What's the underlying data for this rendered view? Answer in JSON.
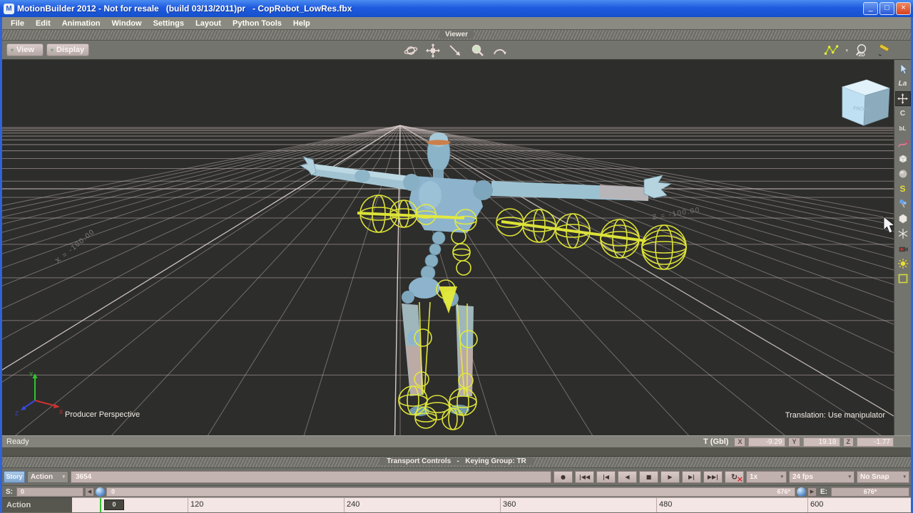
{
  "window": {
    "title": "MotionBuilder 2012 - Not for resale   (build 03/13/2011)pr   - CopRobot_LowRes.fbx",
    "app_icon_glyph": "M",
    "minimize_glyph": "_",
    "maximize_glyph": "□",
    "close_glyph": "×"
  },
  "menu_bar": {
    "items": [
      "File",
      "Edit",
      "Animation",
      "Window",
      "Settings",
      "Layout",
      "Python Tools",
      "Help"
    ]
  },
  "viewer": {
    "header": "Viewer",
    "view_button": "View",
    "display_button": "Display",
    "center_tools": [
      "orbit-icon",
      "pan-icon",
      "select-line-icon",
      "zoom-icon",
      "arc-rotate-icon"
    ],
    "right_tools": [
      "spline-icon",
      "zoom-2d-icon",
      "draw-icon"
    ],
    "zoom_2d_label": "2D",
    "chevron": "▾"
  },
  "viewport": {
    "camera_label": "Producer Perspective",
    "hint_label": "Translation: Use manipulator",
    "grid_label_x": "X = -100.00",
    "grid_label_z": "Z = -100.00",
    "view_cube_face": "FRONT",
    "axis_labels": {
      "x": "X",
      "y": "Y",
      "z": "Z"
    }
  },
  "right_toolbar": {
    "icons": [
      "select-arrow-icon",
      "lasso-icon",
      "translate-icon",
      "rotate-icon",
      "scale-icon",
      "curve-pen-icon",
      "cube-icon",
      "sphere-icon",
      "s-mode-icon",
      "ik-icon",
      "geometry-icon",
      "snowflake-icon",
      "camera-marker-icon",
      "sun-icon",
      "region-frame-icon"
    ],
    "lasso_label": "La",
    "rotate_label": "C",
    "scale_label": "bL",
    "s_label": "S"
  },
  "status_bar": {
    "ready": "Ready",
    "transform_label": "T (Gbl)",
    "x_label": "X",
    "x_value": "-9.29",
    "y_label": "Y",
    "y_value": "19.18",
    "z_label": "Z",
    "z_value": "-1.77"
  },
  "transport": {
    "header": "Transport Controls   -   Keying Group: TR",
    "story_button": "Story",
    "mode_dropdown": "Action",
    "take_field": "3654",
    "buttons": [
      {
        "name": "record",
        "glyph": "●"
      },
      {
        "name": "go-to-start",
        "glyph": "|◀◀"
      },
      {
        "name": "previous-key",
        "glyph": "|◀"
      },
      {
        "name": "step-back",
        "glyph": "◀"
      },
      {
        "name": "stop",
        "glyph": "■"
      },
      {
        "name": "play",
        "glyph": "▶"
      },
      {
        "name": "next-key",
        "glyph": "▶|"
      },
      {
        "name": "go-to-end",
        "glyph": "▶▶|"
      },
      {
        "name": "loop",
        "glyph": "↻"
      }
    ],
    "loop_off_mark": "×",
    "speed_dropdown": "1x",
    "fps_dropdown": "24 fps",
    "snap_dropdown": "No Snap",
    "chevron": "▾"
  },
  "range_row": {
    "start_label": "S:",
    "start_value": "0",
    "loop_start_value": "0",
    "loop_end_value": "676*",
    "end_label": "E:",
    "end_value": "676*",
    "left_arrow": "◀",
    "right_arrow": "▶"
  },
  "timeline": {
    "track_label": "Action",
    "playhead_value": "0",
    "ticks": [
      "120",
      "240",
      "360",
      "480",
      "600"
    ]
  }
}
